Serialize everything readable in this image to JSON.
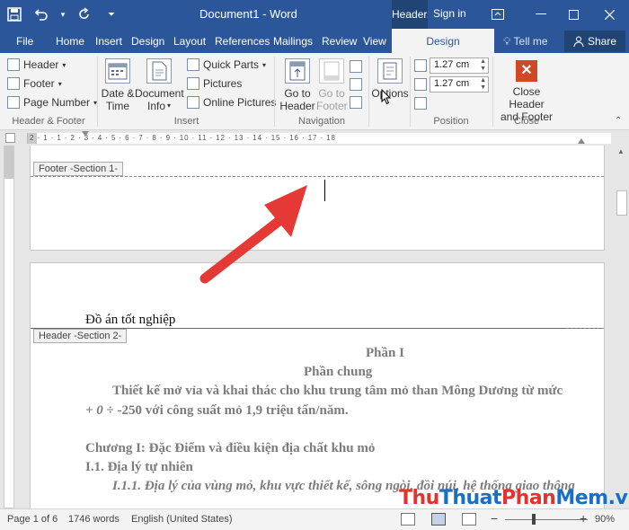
{
  "titlebar": {
    "doc_title": "Document1 - Word",
    "context_tab": "Header...",
    "signin": "Sign in"
  },
  "tabs": [
    "File",
    "Home",
    "Insert",
    "Design",
    "Layout",
    "References",
    "Mailings",
    "Review",
    "View"
  ],
  "active_tab": "Design",
  "tell_me": "Tell me",
  "share": "Share",
  "ribbon": {
    "header_footer": {
      "header": "Header",
      "footer": "Footer",
      "page_number": "Page Number",
      "group_label": "Header & Footer"
    },
    "insert": {
      "date_time_1": "Date &",
      "date_time_2": "Time",
      "doc_info_1": "Document",
      "doc_info_2": "Info",
      "quick_parts": "Quick Parts",
      "pictures": "Pictures",
      "online_pictures": "Online Pictures",
      "group_label": "Insert"
    },
    "navigation": {
      "goto_header_1": "Go to",
      "goto_header_2": "Header",
      "goto_footer_1": "Go to",
      "goto_footer_2": "Footer",
      "group_label": "Navigation"
    },
    "options": "Options",
    "position": {
      "top": "1.27 cm",
      "bottom": "1.27 cm",
      "group_label": "Position"
    },
    "close": {
      "label_1": "Close Header",
      "label_2": "and Footer",
      "group_label": "Close"
    }
  },
  "ruler_numbers": "2 · 1 · 1 · 2 · 3 · 4 · 5 · 6 · 7 · 8 · 9 · 10 · 11 · 12 · 13 · 14 · 15 · 16 · 17 · 18",
  "document": {
    "footer_label": "Footer -Section 1-",
    "header_label": "Header -Section 2-",
    "header_text": "Đồ án tốt nghiệp",
    "lines": {
      "l1": "Phần I",
      "l2": "Phần chung",
      "l3": "Thiết kế mở vỉa và khai thác cho khu trung tâm mỏ than Mông Dương từ mức",
      "l4a": "+ 0 ÷",
      "l4b": "-250 với công suất mỏ 1,9 triệu tấn/năm.",
      "l5": "Chương I: Đặc Điểm và điều kiện địa chất khu mỏ",
      "l6": "I.1. Địa lý tự  nhiên",
      "l7": "I.1.1. Địa lý của vùng mỏ, khu vực thiết kế, sông ngòi, đồi núi, hệ thống giao thông"
    }
  },
  "statusbar": {
    "page": "Page 1 of 6",
    "words": "1746 words",
    "language": "English (United States)",
    "zoom": "90%"
  },
  "watermark": {
    "p1": "Thu",
    "p2": "Thuat",
    "p3": "Phan",
    "p4": "Mem",
    "p5": ".vn"
  },
  "colors": {
    "accent": "#2b579a",
    "arrow": "#e53935",
    "close_icon": "#d24726"
  }
}
